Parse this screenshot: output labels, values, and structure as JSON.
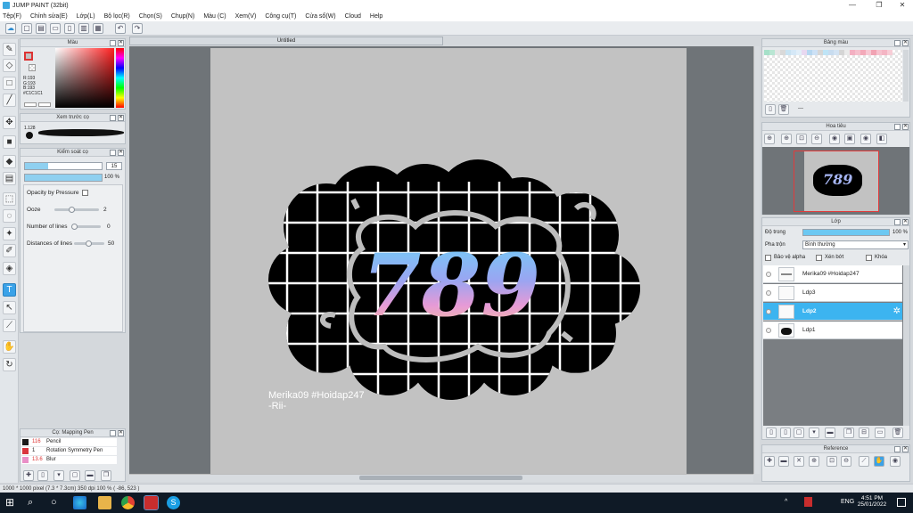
{
  "window": {
    "title": "JUMP PAINT (32bit)",
    "min": "—",
    "max": "❐",
    "close": "✕"
  },
  "menu": [
    "Tệp(F)",
    "Chỉnh sửa(E)",
    "Lớp(L)",
    "Bộ lọc(R)",
    "Chọn(S)",
    "Chụp(N)",
    "Màu (C)",
    "Xem(V)",
    "Công cụ(T)",
    "Cửa sổ(W)",
    "Cloud",
    "Help"
  ],
  "document": {
    "tab_title": "Untitled"
  },
  "color_panel": {
    "title": "Màu",
    "r": "R:193",
    "g": "G:193",
    "b": "B:193",
    "hex": "#C1C1C1"
  },
  "brush_preview": {
    "title": "Xem trước cọ",
    "size": "1.128"
  },
  "brush_control": {
    "title": "Kiểm soát cọ",
    "size_value": "15",
    "opacity_value": "100 %",
    "opacity_pressure_label": "Opacity by Pressure",
    "ooze_label": "Ooze",
    "ooze_value": "2",
    "lines_label": "Number of lines",
    "lines_value": "0",
    "distance_label": "Distances of lines",
    "distance_value": "50"
  },
  "brush_mapping": {
    "title": "Cọ: Mapping Pen",
    "items": [
      {
        "num": "116",
        "name": "Pencil",
        "swatch": "#1a1a1a"
      },
      {
        "num": "1",
        "name": "Rotation Symmetry Pen",
        "swatch": "#d9363e"
      },
      {
        "num": "13.6",
        "name": "Blur",
        "swatch": "#e98fc7"
      }
    ]
  },
  "palette": {
    "title": "Bảng màu",
    "more": "---"
  },
  "navigator": {
    "title": "Hoa tiêu"
  },
  "layer_panel": {
    "title": "Lớp",
    "opacity_label": "Độ trong",
    "opacity_value": "100 %",
    "blend_label": "Pha trộn",
    "blend_value": "Bình thường",
    "protect_alpha": "Bảo vệ alpha",
    "clip": "Xén bớt",
    "lock": "Khóa",
    "layers": [
      {
        "name": "Merika09 #Hoidap247",
        "selected": false
      },
      {
        "name": "Ldp3",
        "selected": false
      },
      {
        "name": "Ldp2",
        "selected": true
      },
      {
        "name": "Ldp1",
        "selected": false
      }
    ]
  },
  "reference": {
    "title": "Reference"
  },
  "artwork": {
    "number_text": "789",
    "watermark_line1": "Merika09 #Hoidap247",
    "watermark_line2": "-Rii-"
  },
  "status": "1000 * 1000 pixel  (7.3 * 7.3cm)  350 dpi  100 %  ( -86, 523 )",
  "taskbar": {
    "lang": "ENG",
    "time": "4:51 PM",
    "date": "25/01/2022"
  }
}
